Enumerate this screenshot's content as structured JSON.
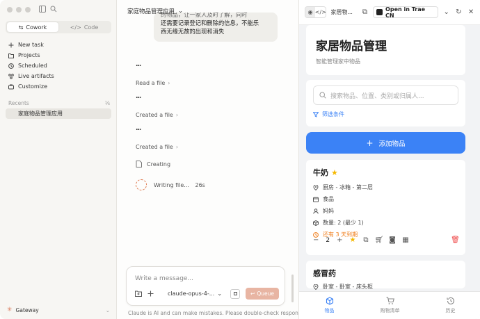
{
  "sidebar": {
    "mode_tabs": [
      {
        "label": "Cowork",
        "active": true
      },
      {
        "label": "Code",
        "active": false
      }
    ],
    "nav": [
      {
        "label": "New task",
        "icon": "plus-icon"
      },
      {
        "label": "Projects",
        "icon": "folder-icon"
      },
      {
        "label": "Scheduled",
        "icon": "clock-icon"
      },
      {
        "label": "Live artifacts",
        "icon": "artifact-icon"
      },
      {
        "label": "Customize",
        "icon": "briefcase-icon"
      }
    ],
    "recents_label": "Recents",
    "recent_items": [
      "家庭物品管理应用"
    ],
    "footer_label": "Gateway"
  },
  "chat": {
    "title": "家庭物品管理应用",
    "bubble_clipped": "的物品，让一家人及时了解，同时",
    "bubble_lines": [
      "还需要记录登记和删除的信息，不能乐",
      "西无缘无故的出现和消失"
    ],
    "ellipsis": "...",
    "steps": [
      {
        "label": "Read a file"
      },
      {
        "label": "Created a file"
      },
      {
        "label": "Created a file"
      }
    ],
    "creating_label": "Creating",
    "writing_label": "Writing file...",
    "writing_time": "26s",
    "input_placeholder": "Write a message...",
    "model": "claude-opus-4-...",
    "queue_label": "Queue",
    "disclaimer": "Claude is AI and can make mistakes. Please double-check responses."
  },
  "preview": {
    "tab_title": "家居物...",
    "open_button": "Open in Trae CN",
    "app_title": "家居物品管理",
    "app_subtitle": "智能管理家中物品",
    "search_placeholder": "搜索物品、位置、类别或归属人...",
    "filter_label": "筛选条件",
    "add_label": "添加物品",
    "items": [
      {
        "name": "牛奶",
        "location": "厨房 - 冰箱 - 第二层",
        "category": "食品",
        "owner": "妈妈",
        "quantity_text": "数量: 2 (最少 1)",
        "expiry_text": "还有 3 天到期",
        "qty": "2"
      },
      {
        "name": "感冒药",
        "location": "卧室 - 卧室 - 床头柜"
      }
    ],
    "bottom_nav": [
      {
        "label": "物品",
        "active": true
      },
      {
        "label": "购物清单",
        "active": false
      },
      {
        "label": "历史",
        "active": false
      }
    ]
  }
}
